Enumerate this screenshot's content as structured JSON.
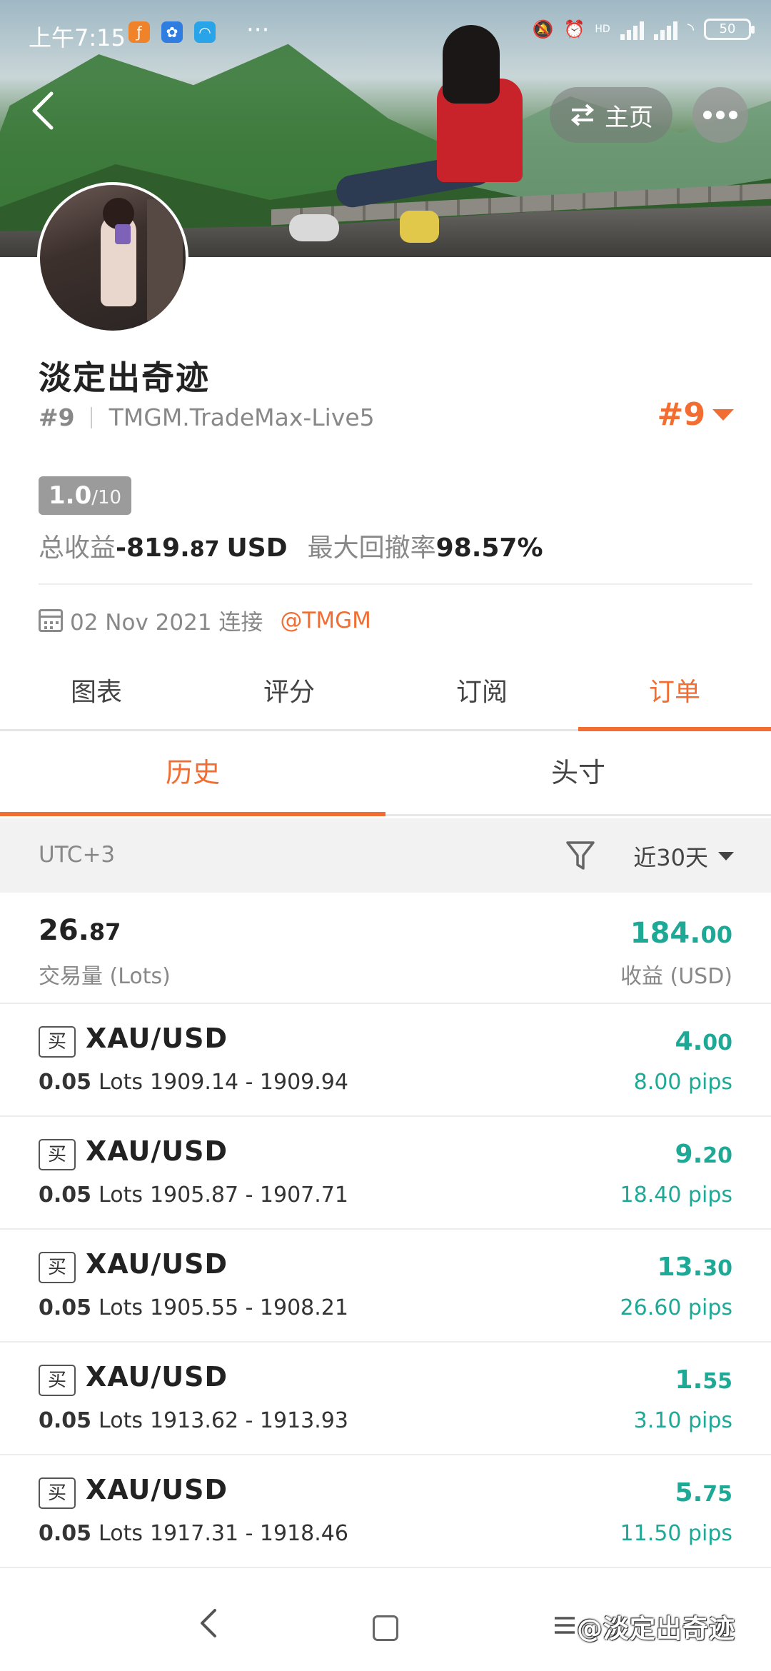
{
  "status_bar": {
    "time": "上午7:15",
    "battery": "50",
    "signal_label": "HD"
  },
  "header": {
    "home_label": "主页"
  },
  "profile": {
    "name": "淡定出奇迹",
    "rank": "#9",
    "server": "TMGM.TradeMax-Live5",
    "rank_badge": "#9",
    "score": "1.0",
    "score_max": "/10",
    "total_profit_label": "总收益",
    "total_profit_int": "-819.",
    "total_profit_dec": "87",
    "total_profit_unit": "USD",
    "max_drawdown_label": "最大回撤率",
    "max_drawdown_value": "98.57%",
    "joined_date": "02 Nov 2021 连接",
    "broker": "@TMGM"
  },
  "main_tabs": [
    {
      "label": "图表",
      "active": false
    },
    {
      "label": "评分",
      "active": false
    },
    {
      "label": "订阅",
      "active": false
    },
    {
      "label": "订单",
      "active": true
    }
  ],
  "sub_tabs": [
    {
      "label": "历史",
      "active": true
    },
    {
      "label": "头寸",
      "active": false
    }
  ],
  "filter": {
    "timezone": "UTC+3",
    "period": "近30天"
  },
  "summary": {
    "volume_int": "26.",
    "volume_dec": "87",
    "volume_label": "交易量 (Lots)",
    "profit_int": "184.",
    "profit_dec": "00",
    "profit_label": "收益 (USD)"
  },
  "trades": [
    {
      "side": "买",
      "symbol": "XAU/USD",
      "lots": "0.05",
      "lots_unit": "Lots",
      "range": "1909.14 - 1909.94",
      "pnl_int": "4.",
      "pnl_dec": "00",
      "pips": "8.00 pips"
    },
    {
      "side": "买",
      "symbol": "XAU/USD",
      "lots": "0.05",
      "lots_unit": "Lots",
      "range": "1905.87 - 1907.71",
      "pnl_int": "9.",
      "pnl_dec": "20",
      "pips": "18.40 pips"
    },
    {
      "side": "买",
      "symbol": "XAU/USD",
      "lots": "0.05",
      "lots_unit": "Lots",
      "range": "1905.55 - 1908.21",
      "pnl_int": "13.",
      "pnl_dec": "30",
      "pips": "26.60 pips"
    },
    {
      "side": "买",
      "symbol": "XAU/USD",
      "lots": "0.05",
      "lots_unit": "Lots",
      "range": "1913.62 - 1913.93",
      "pnl_int": "1.",
      "pnl_dec": "55",
      "pips": "3.10 pips"
    },
    {
      "side": "买",
      "symbol": "XAU/USD",
      "lots": "0.05",
      "lots_unit": "Lots",
      "range": "1917.31 - 1918.46",
      "pnl_int": "5.",
      "pnl_dec": "75",
      "pips": "11.50 pips"
    }
  ],
  "watermark": "@淡定出奇迹",
  "colors": {
    "accent": "#f26d32",
    "profit": "#1ea896"
  }
}
